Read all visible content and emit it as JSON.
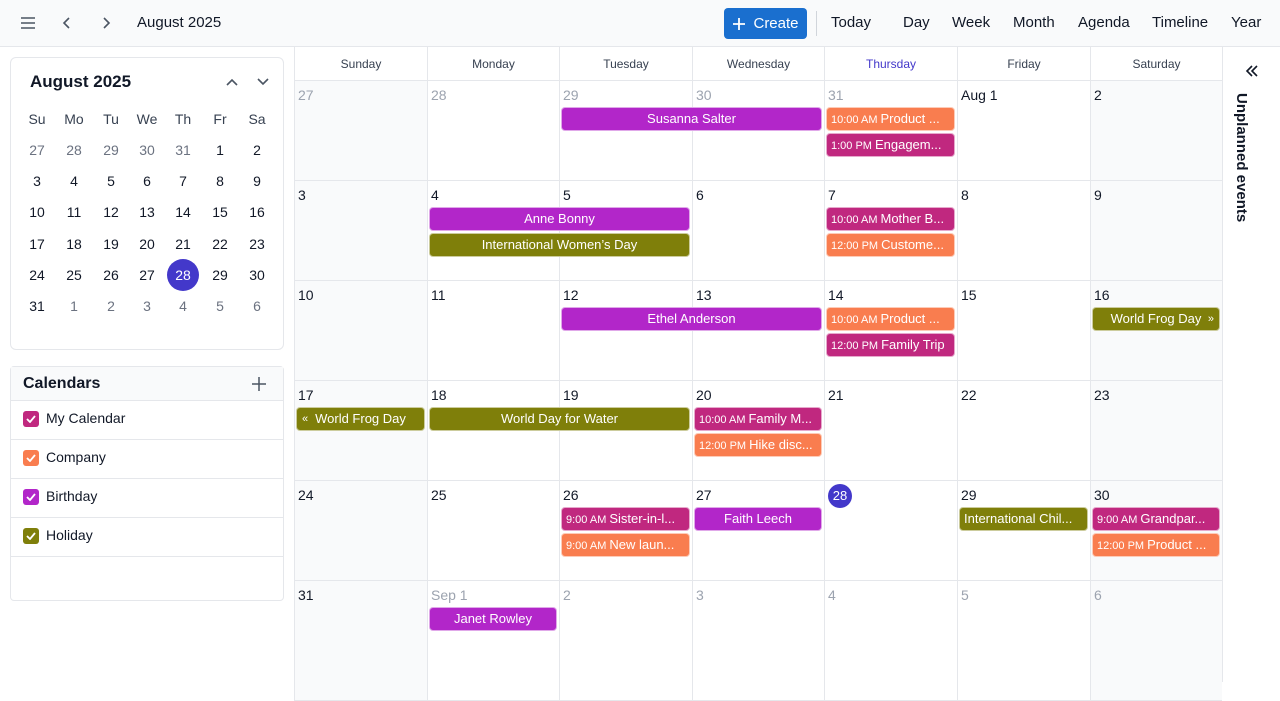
{
  "header": {
    "title": "August 2025",
    "create_label": "Create",
    "views": [
      "Today",
      "Day",
      "Week",
      "Month",
      "Agenda",
      "Timeline",
      "Year"
    ],
    "brand_color": "#1a6fcf"
  },
  "mini_calendar": {
    "title": "August 2025",
    "dow": [
      "Su",
      "Mo",
      "Tu",
      "We",
      "Th",
      "Fr",
      "Sa"
    ],
    "weeks": [
      [
        "27",
        "28",
        "29",
        "30",
        "31",
        "1",
        "2"
      ],
      [
        "3",
        "4",
        "5",
        "6",
        "7",
        "8",
        "9"
      ],
      [
        "10",
        "11",
        "12",
        "13",
        "14",
        "15",
        "16"
      ],
      [
        "17",
        "18",
        "19",
        "20",
        "21",
        "22",
        "23"
      ],
      [
        "24",
        "25",
        "26",
        "27",
        "28",
        "29",
        "30"
      ],
      [
        "31",
        "1",
        "2",
        "3",
        "4",
        "5",
        "6"
      ]
    ],
    "today": "28",
    "today_color": "#4338ca"
  },
  "calendars": {
    "title": "Calendars",
    "items": [
      {
        "label": "My Calendar",
        "color": "#c0287f"
      },
      {
        "label": "Company",
        "color": "#f97d4f"
      },
      {
        "label": "Birthday",
        "color": "#b226c9"
      },
      {
        "label": "Holiday",
        "color": "#7f7f0a"
      }
    ]
  },
  "month": {
    "dow": [
      "Sunday",
      "Monday",
      "Tuesday",
      "Wednesday",
      "Thursday",
      "Friday",
      "Saturday"
    ],
    "highlight_dow": "Thursday",
    "weeks": [
      [
        "27",
        "28",
        "29",
        "30",
        "31",
        "Aug 1",
        "2"
      ],
      [
        "3",
        "4",
        "5",
        "6",
        "7",
        "8",
        "9"
      ],
      [
        "10",
        "11",
        "12",
        "13",
        "14",
        "15",
        "16"
      ],
      [
        "17",
        "18",
        "19",
        "20",
        "21",
        "22",
        "23"
      ],
      [
        "24",
        "25",
        "26",
        "27",
        "28",
        "29",
        "30"
      ],
      [
        "31",
        "Sep 1",
        "2",
        "3",
        "4",
        "5",
        "6"
      ]
    ],
    "muted_before": 5,
    "muted_after_week": 5,
    "muted_after_col": 1,
    "today_week": 4,
    "today_col": 4,
    "events": [
      {
        "week": 0,
        "col": 2,
        "span": 2,
        "slot": 0,
        "title": "Susanna Salter",
        "color": "#b226c9"
      },
      {
        "week": 0,
        "col": 4,
        "span": 1,
        "slot": 0,
        "time": "10:00 AM",
        "title": "Product ...",
        "color": "#f97d4f"
      },
      {
        "week": 0,
        "col": 4,
        "span": 1,
        "slot": 1,
        "time": "1:00 PM",
        "title": "Engagem...",
        "color": "#c0287f"
      },
      {
        "week": 1,
        "col": 1,
        "span": 2,
        "slot": 0,
        "title": "Anne Bonny",
        "color": "#b226c9"
      },
      {
        "week": 1,
        "col": 1,
        "span": 2,
        "slot": 1,
        "title": "International Women’s Day",
        "color": "#7f7f0a"
      },
      {
        "week": 1,
        "col": 4,
        "span": 1,
        "slot": 0,
        "time": "10:00 AM",
        "title": "Mother B...",
        "color": "#c0287f"
      },
      {
        "week": 1,
        "col": 4,
        "span": 1,
        "slot": 1,
        "time": "12:00 PM",
        "title": "Custome...",
        "color": "#f97d4f"
      },
      {
        "week": 2,
        "col": 2,
        "span": 2,
        "slot": 0,
        "title": "Ethel Anderson",
        "color": "#b226c9"
      },
      {
        "week": 2,
        "col": 4,
        "span": 1,
        "slot": 0,
        "time": "10:00 AM",
        "title": "Product ...",
        "color": "#f97d4f"
      },
      {
        "week": 2,
        "col": 4,
        "span": 1,
        "slot": 1,
        "time": "12:00 PM",
        "title": "Family Trip",
        "color": "#c0287f"
      },
      {
        "week": 2,
        "col": 6,
        "span": 1,
        "slot": 0,
        "title": "World Frog Day",
        "color": "#7f7f0a",
        "cont_right": "»"
      },
      {
        "week": 3,
        "col": 0,
        "span": 1,
        "slot": 0,
        "title": "World Frog Day",
        "color": "#7f7f0a",
        "cont_left": "«"
      },
      {
        "week": 3,
        "col": 1,
        "span": 2,
        "slot": 0,
        "title": "World Day for Water",
        "color": "#7f7f0a"
      },
      {
        "week": 3,
        "col": 3,
        "span": 1,
        "slot": 0,
        "time": "10:00 AM",
        "title": "Family M...",
        "color": "#c0287f"
      },
      {
        "week": 3,
        "col": 3,
        "span": 1,
        "slot": 1,
        "time": "12:00 PM",
        "title": "Hike disc...",
        "color": "#f97d4f"
      },
      {
        "week": 4,
        "col": 2,
        "span": 1,
        "slot": 0,
        "time": "9:00 AM",
        "title": "Sister-in-l...",
        "color": "#c0287f"
      },
      {
        "week": 4,
        "col": 2,
        "span": 1,
        "slot": 1,
        "time": "9:00 AM",
        "title": "New laun...",
        "color": "#f97d4f"
      },
      {
        "week": 4,
        "col": 3,
        "span": 1,
        "slot": 0,
        "title": "Faith Leech",
        "color": "#b226c9"
      },
      {
        "week": 4,
        "col": 5,
        "span": 1,
        "slot": 0,
        "title": "International Chil...",
        "color": "#7f7f0a",
        "left_align": true
      },
      {
        "week": 4,
        "col": 6,
        "span": 1,
        "slot": 0,
        "time": "9:00 AM",
        "title": "Grandpar...",
        "color": "#c0287f"
      },
      {
        "week": 4,
        "col": 6,
        "span": 1,
        "slot": 1,
        "time": "12:00 PM",
        "title": "Product ...",
        "color": "#f97d4f"
      },
      {
        "week": 5,
        "col": 1,
        "span": 1,
        "slot": 0,
        "title": "Janet Rowley",
        "color": "#b226c9"
      }
    ]
  },
  "sidebar_right": {
    "label": "Unplanned events"
  }
}
